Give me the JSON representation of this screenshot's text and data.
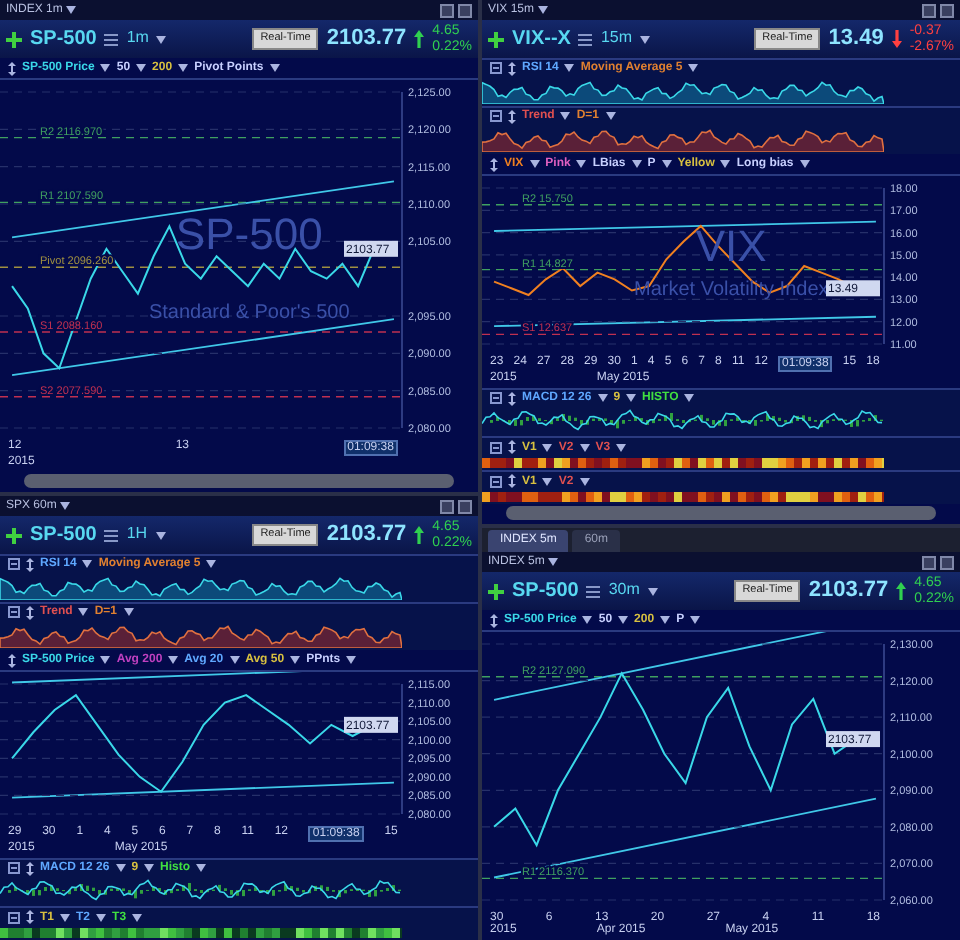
{
  "columns": [
    {
      "panels": [
        {
          "title": "INDEX 1m",
          "symbol": "SP-500",
          "interval": "1m",
          "realtime": "Real-Time",
          "price": "2103.77",
          "change": "4.65",
          "change_pct": "0.22%",
          "rising": true,
          "legend": [
            {
              "text": "50",
              "color": "#c8d0ff"
            },
            {
              "text": "200",
              "color": "#d8c040"
            },
            {
              "text": "Pivot Points",
              "color": "#c8d0ff"
            }
          ],
          "watermark": [
            "SP-500",
            "Standard & Poor's 500"
          ],
          "price_tag": "2103.77",
          "chart_data": {
            "type": "line",
            "grid": true,
            "ylim": [
              2080,
              2125
            ],
            "yticks": [
              {
                "value": 2125,
                "label": "2,125.00"
              },
              {
                "value": 2120,
                "label": "2,120.00"
              },
              {
                "value": 2115,
                "label": "2,115.00"
              },
              {
                "value": 2110,
                "label": "2,110.00"
              },
              {
                "value": 2105,
                "label": "2,105.00"
              },
              {
                "value": 2095,
                "label": "2,095.00"
              },
              {
                "value": 2090,
                "label": "2,090.00"
              },
              {
                "value": 2085,
                "label": "2,085.00"
              },
              {
                "value": 2080,
                "label": "2,080.00"
              }
            ],
            "series": [
              {
                "name": "SP-500 Price",
                "color": "#3ad8e8",
                "values": [
                  2099,
                  2096,
                  2090,
                  2088,
                  2094,
                  2100,
                  2104,
                  2101,
                  2098,
                  2103,
                  2107,
                  2102,
                  2100,
                  2103,
                  2101,
                  2099,
                  2102,
                  2100,
                  2104,
                  2101,
                  2100,
                  2102,
                  2099,
                  2104
                ]
              }
            ]
          },
          "pivots": [
            {
              "label": "R2 2116.970",
              "color": "#40a060"
            },
            {
              "label": "R1 2107.590",
              "color": "#40a060"
            },
            {
              "label": "Pivot 2096.260",
              "color": "#a09040"
            },
            {
              "label": "S1 2088.160",
              "color": "#c03050"
            },
            {
              "label": "S2 2077.590",
              "color": "#c03050"
            }
          ],
          "x_axis": {
            "ticks": [
              {
                "text": "12",
                "kind": "day"
              },
              {
                "text": "13",
                "kind": "day"
              },
              {
                "text": "01:09:38",
                "kind": "cursor"
              }
            ],
            "sub": [
              "2015"
            ]
          },
          "scrollbar": true
        },
        {
          "title": "SPX 60m",
          "symbol": "SP-500",
          "interval": "1H",
          "realtime": "Real-Time",
          "price": "2103.77",
          "change": "4.65",
          "change_pct": "0.22%",
          "rising": true,
          "upper": [
            {
              "kind": "area",
              "legend": [
                {
                  "text": "RSI 14",
                  "color": "#5fa8ff"
                },
                {
                  "text": "Moving Average 5",
                  "color": "#e08030"
                }
              ]
            },
            {
              "kind": "area",
              "legend": [
                {
                  "text": "Trend",
                  "color": "#e05050"
                },
                {
                  "text": "D=1",
                  "color": "#e08030"
                }
              ]
            }
          ],
          "legend": [
            {
              "text": "Avg 200",
              "color": "#c040c0"
            },
            {
              "text": "Avg 20",
              "color": "#5fa8ff"
            },
            {
              "text": "Avg 50",
              "color": "#d8c040"
            },
            {
              "text": "PPnts",
              "color": "#c8d0ff"
            }
          ],
          "price_tag": "2103.77",
          "chart_data": {
            "type": "line",
            "grid": true,
            "ylim": [
              2080,
              2115
            ],
            "yticks": [
              {
                "value": 2115,
                "label": "2,115.00"
              },
              {
                "value": 2110,
                "label": "2,110.00"
              },
              {
                "value": 2105,
                "label": "2,105.00"
              },
              {
                "value": 2100,
                "label": "2,100.00"
              },
              {
                "value": 2095,
                "label": "2,095.00"
              },
              {
                "value": 2090,
                "label": "2,090.00"
              },
              {
                "value": 2085,
                "label": "2,085.00"
              },
              {
                "value": 2080,
                "label": "2,080.00"
              }
            ],
            "series": [
              {
                "name": "SP-500 Price",
                "color": "#3ad8e8",
                "values": [
                  2095,
                  2102,
                  2108,
                  2112,
                  2104,
                  2096,
                  2090,
                  2086,
                  2094,
                  2104,
                  2110,
                  2112,
                  2108,
                  2104,
                  2099,
                  2104,
                  2101,
                  2104
                ]
              }
            ]
          },
          "x_axis": {
            "ticks": [
              {
                "text": "29",
                "kind": "day"
              },
              {
                "text": "30",
                "kind": "day"
              },
              {
                "text": "1",
                "kind": "day"
              },
              {
                "text": "4",
                "kind": "day"
              },
              {
                "text": "5",
                "kind": "day"
              },
              {
                "text": "6",
                "kind": "day"
              },
              {
                "text": "7",
                "kind": "day"
              },
              {
                "text": "8",
                "kind": "day"
              },
              {
                "text": "11",
                "kind": "day"
              },
              {
                "text": "12",
                "kind": "day"
              },
              {
                "text": "01:09:38",
                "kind": "cursor"
              },
              {
                "text": "15",
                "kind": "day"
              }
            ],
            "sub": [
              "2015",
              "May 2015"
            ]
          },
          "lower": [
            {
              "kind": "macd",
              "legend": [
                {
                  "text": "MACD 12 26",
                  "color": "#5fa8ff"
                },
                {
                  "text": "9",
                  "color": "#d8c040"
                },
                {
                  "text": "Histo",
                  "color": "#40e040"
                }
              ]
            },
            {
              "kind": "greenheat",
              "legend": [
                {
                  "text": "T1",
                  "color": "#d8c040"
                },
                {
                  "text": "T2",
                  "color": "#5fa8ff"
                },
                {
                  "text": "T3",
                  "color": "#40e040"
                }
              ]
            }
          ]
        }
      ]
    },
    {
      "panels": [
        {
          "title": "VIX 15m",
          "symbol": "VIX--X",
          "interval": "15m",
          "realtime": "Real-Time",
          "price": "13.49",
          "change": "-0.37",
          "change_pct": "-2.67%",
          "rising": false,
          "upper": [
            {
              "kind": "area",
              "legend": [
                {
                  "text": "RSI 14",
                  "color": "#5fa8ff"
                },
                {
                  "text": "Moving Average 5",
                  "color": "#e08030"
                }
              ]
            },
            {
              "kind": "area",
              "legend": [
                {
                  "text": "Trend",
                  "color": "#e05050"
                },
                {
                  "text": "D=1",
                  "color": "#e08030"
                }
              ]
            }
          ],
          "legend": [
            {
              "text": "Pink",
              "color": "#e060c0"
            },
            {
              "text": "LBias",
              "color": "#c8d0ff"
            },
            {
              "text": "P",
              "color": "#c8d0ff"
            },
            {
              "text": "Yellow",
              "color": "#d8c040"
            },
            {
              "text": "Long bias",
              "color": "#c8d0ff"
            }
          ],
          "watermark": [
            "VIX",
            "Market Volatility Index"
          ],
          "price_tag": "13.49",
          "chart_data": {
            "type": "line",
            "grid": true,
            "ylim": [
              11,
              18
            ],
            "yticks": [
              {
                "value": 18,
                "label": "18.00"
              },
              {
                "value": 17,
                "label": "17.00"
              },
              {
                "value": 16,
                "label": "16.00"
              },
              {
                "value": 15,
                "label": "15.00"
              },
              {
                "value": 14,
                "label": "14.00"
              },
              {
                "value": 13,
                "label": "13.00"
              },
              {
                "value": 12,
                "label": "12.00"
              },
              {
                "value": 11,
                "label": "11.00"
              }
            ],
            "series": [
              {
                "name": "VIX",
                "color": "#f08020",
                "values": [
                  13.8,
                  13.5,
                  13.2,
                  13.9,
                  14.4,
                  13.6,
                  14.2,
                  13.9,
                  13.4,
                  13.6,
                  14.8,
                  15.6,
                  16.3,
                  15.4,
                  14.6,
                  13.8,
                  13.3,
                  13.6,
                  14.5,
                  14.2,
                  13.9,
                  13.5
                ]
              }
            ]
          },
          "pivots": [
            {
              "label": "R2 15.750",
              "color": "#40a060"
            },
            {
              "label": "R1 14.827",
              "color": "#40a060"
            },
            {
              "label": "S1 12.637",
              "color": "#c03050"
            }
          ],
          "x_axis": {
            "ticks": [
              {
                "text": "23",
                "kind": "day"
              },
              {
                "text": "24",
                "kind": "day"
              },
              {
                "text": "27",
                "kind": "day"
              },
              {
                "text": "28",
                "kind": "day"
              },
              {
                "text": "29",
                "kind": "day"
              },
              {
                "text": "30",
                "kind": "day"
              },
              {
                "text": "1",
                "kind": "day"
              },
              {
                "text": "4",
                "kind": "day"
              },
              {
                "text": "5",
                "kind": "day"
              },
              {
                "text": "6",
                "kind": "day"
              },
              {
                "text": "7",
                "kind": "day"
              },
              {
                "text": "8",
                "kind": "day"
              },
              {
                "text": "11",
                "kind": "day"
              },
              {
                "text": "12",
                "kind": "day"
              },
              {
                "text": "01:09:38",
                "kind": "cursor"
              },
              {
                "text": "15",
                "kind": "day"
              },
              {
                "text": "18",
                "kind": "day"
              }
            ],
            "sub": [
              "2015",
              "May 2015"
            ]
          },
          "lower": [
            {
              "kind": "macd",
              "legend": [
                {
                  "text": "MACD 12 26",
                  "color": "#5fa8ff"
                },
                {
                  "text": "9",
                  "color": "#d8c040"
                },
                {
                  "text": "HISTO",
                  "color": "#40e040"
                }
              ]
            },
            {
              "kind": "heat",
              "legend": [
                {
                  "text": "V1",
                  "color": "#d8c040"
                },
                {
                  "text": "V2",
                  "color": "#e05050"
                },
                {
                  "text": "V3",
                  "color": "#e05050"
                }
              ]
            },
            {
              "kind": "heat",
              "legend": [
                {
                  "text": "V1",
                  "color": "#d8c040"
                },
                {
                  "text": "V2",
                  "color": "#e05050"
                }
              ]
            }
          ],
          "scrollbar": true
        },
        {
          "tabs": [
            {
              "label": "INDEX 5m",
              "selected": true
            },
            {
              "label": "60m",
              "selected": false
            }
          ],
          "title": "INDEX 5m",
          "symbol": "SP-500",
          "interval": "30m",
          "realtime": "Real-Time",
          "price": "2103.77",
          "change": "4.65",
          "change_pct": "0.22%",
          "rising": true,
          "legend": [
            {
              "text": "50",
              "color": "#c8d0ff"
            },
            {
              "text": "200",
              "color": "#d8c040"
            },
            {
              "text": "P",
              "color": "#c8d0ff"
            }
          ],
          "price_tag": "2103.77",
          "chart_data": {
            "type": "line",
            "grid": true,
            "ylim": [
              2060,
              2130
            ],
            "yticks": [
              {
                "value": 2130,
                "label": "2,130.00"
              },
              {
                "value": 2120,
                "label": "2,120.00"
              },
              {
                "value": 2110,
                "label": "2,110.00"
              },
              {
                "value": 2100,
                "label": "2,100.00"
              },
              {
                "value": 2090,
                "label": "2,090.00"
              },
              {
                "value": 2080,
                "label": "2,080.00"
              },
              {
                "value": 2070,
                "label": "2,070.00"
              },
              {
                "value": 2060,
                "label": "2,060.00"
              }
            ],
            "series": [
              {
                "name": "SP-500 Price",
                "color": "#3ad8e8",
                "values": [
                  2080,
                  2085,
                  2075,
                  2090,
                  2100,
                  2110,
                  2122,
                  2112,
                  2100,
                  2092,
                  2110,
                  2118,
                  2102,
                  2090,
                  2108,
                  2115,
                  2100,
                  2104
                ]
              }
            ]
          },
          "pivots": [
            {
              "label": "R2 2127.090",
              "color": "#40a060"
            },
            {
              "label": "R1 2116.370",
              "color": "#40a060"
            }
          ],
          "x_axis": {
            "ticks": [
              {
                "text": "30",
                "kind": "day"
              },
              {
                "text": "6",
                "kind": "day"
              },
              {
                "text": "13",
                "kind": "day"
              },
              {
                "text": "20",
                "kind": "day"
              },
              {
                "text": "27",
                "kind": "day"
              },
              {
                "text": "4",
                "kind": "day"
              },
              {
                "text": "11",
                "kind": "day"
              },
              {
                "text": "18",
                "kind": "day"
              }
            ],
            "sub": [
              "2015",
              "Apr 2015",
              "May 2015"
            ]
          }
        }
      ]
    }
  ]
}
